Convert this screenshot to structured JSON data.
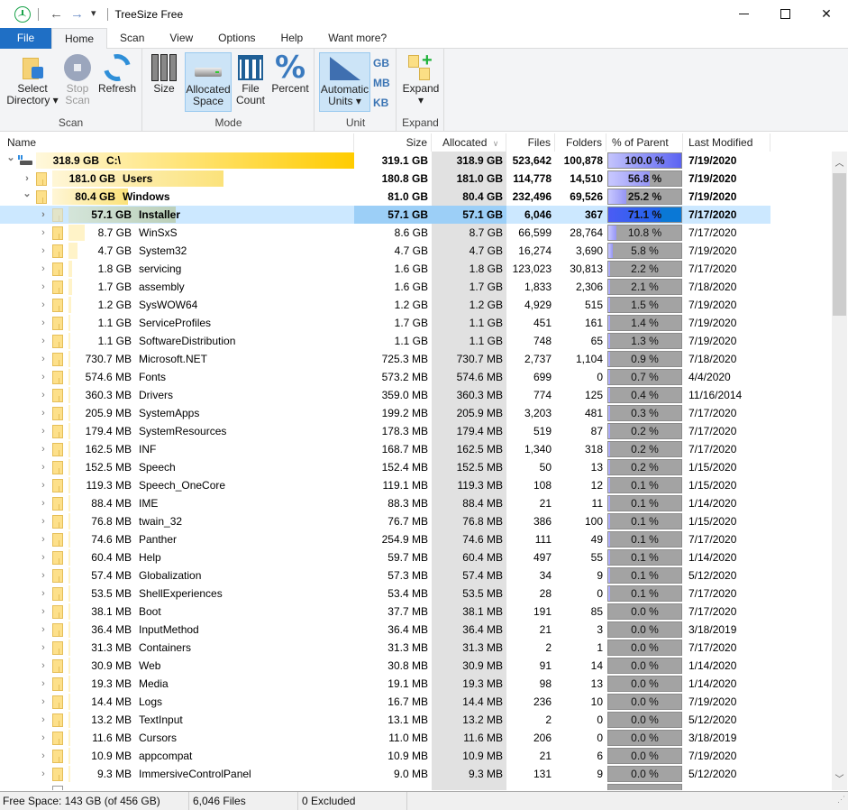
{
  "window": {
    "title": "TreeSize Free",
    "back_icon": "arrow-left-icon",
    "forward_icon": "arrow-right-icon",
    "quick_access_icon": "quick-access-dropdown-icon",
    "minimize_icon": "minimize-icon",
    "maximize_icon": "maximize-icon",
    "close_icon": "close-icon"
  },
  "ribbon_tabs": [
    "File",
    "Home",
    "Scan",
    "View",
    "Options",
    "Help",
    "Want more?"
  ],
  "active_tab": "Home",
  "ribbon": {
    "groups": {
      "scan": "Scan",
      "mode": "Mode",
      "unit": "Unit",
      "expand": "Expand"
    },
    "buttons": {
      "select_directory": [
        "Select",
        "Directory ▾"
      ],
      "stop_scan": [
        "Stop",
        "Scan"
      ],
      "refresh": [
        "Refresh",
        ""
      ],
      "size": [
        "Size",
        ""
      ],
      "allocated_space": [
        "Allocated",
        "Space"
      ],
      "file_count": [
        "File",
        "Count"
      ],
      "percent": [
        "Percent",
        ""
      ],
      "automatic_units": [
        "Automatic",
        "Units ▾"
      ],
      "gb": "GB",
      "mb": "MB",
      "kb": "KB",
      "expand": [
        "Expand",
        "▾"
      ]
    }
  },
  "columns": {
    "name": "Name",
    "size": "Size",
    "allocated": "Allocated",
    "files": "Files",
    "folders": "Folders",
    "percent_parent": "% of Parent ...",
    "last_modified": "Last Modified"
  },
  "sort_column": "allocated",
  "rows": [
    {
      "level": 0,
      "expanded": true,
      "type": "drive",
      "bold": true,
      "allocated_label": "318.9 GB",
      "name": "C:\\",
      "size": "319.1 GB",
      "allocated": "318.9 GB",
      "files": "523,642",
      "folders": "100,878",
      "percent": 100.0,
      "percent_label": "100.0 %",
      "modified": "7/19/2020",
      "namebar": 1.0
    },
    {
      "level": 1,
      "expanded": false,
      "type": "folder",
      "bold": true,
      "name": "Users",
      "size": "180.8 GB",
      "allocated": "181.0 GB",
      "files": "114,778",
      "folders": "14,510",
      "percent": 56.8,
      "percent_label": "56.8 %",
      "modified": "7/19/2020",
      "namebar": 0.568
    },
    {
      "level": 1,
      "expanded": true,
      "type": "folder",
      "bold": true,
      "name": "Windows",
      "size": "81.0 GB",
      "allocated": "80.4 GB",
      "files": "232,496",
      "folders": "69,526",
      "percent": 25.2,
      "percent_label": "25.2 %",
      "modified": "7/19/2020",
      "namebar": 0.252
    },
    {
      "level": 2,
      "expanded": false,
      "type": "folder",
      "bold": true,
      "selected": true,
      "name": "Installer",
      "size": "57.1 GB",
      "allocated": "57.1 GB",
      "files": "6,046",
      "folders": "367",
      "percent": 71.1,
      "percent_label": "71.1 %",
      "modified": "7/17/2020",
      "namebar": 0.711
    },
    {
      "level": 2,
      "name": "WinSxS",
      "size": "8.6 GB",
      "allocated": "8.7 GB",
      "files": "66,599",
      "folders": "28,764",
      "percent": 10.8,
      "percent_label": "10.8 %",
      "modified": "7/17/2020",
      "namebar": 0.108
    },
    {
      "level": 2,
      "name": "System32",
      "size": "4.7 GB",
      "allocated": "4.7 GB",
      "files": "16,274",
      "folders": "3,690",
      "percent": 5.8,
      "percent_label": "5.8 %",
      "modified": "7/19/2020",
      "namebar": 0.058
    },
    {
      "level": 2,
      "name": "servicing",
      "size": "1.6 GB",
      "allocated": "1.8 GB",
      "files": "123,023",
      "folders": "30,813",
      "percent": 2.2,
      "percent_label": "2.2 %",
      "modified": "7/17/2020",
      "namebar": 0.022
    },
    {
      "level": 2,
      "name": "assembly",
      "size": "1.6 GB",
      "allocated": "1.7 GB",
      "files": "1,833",
      "folders": "2,306",
      "percent": 2.1,
      "percent_label": "2.1 %",
      "modified": "7/18/2020",
      "namebar": 0.021
    },
    {
      "level": 2,
      "name": "SysWOW64",
      "size": "1.2 GB",
      "allocated": "1.2 GB",
      "files": "4,929",
      "folders": "515",
      "percent": 1.5,
      "percent_label": "1.5 %",
      "modified": "7/19/2020",
      "namebar": 0.015
    },
    {
      "level": 2,
      "name": "ServiceProfiles",
      "size": "1.7 GB",
      "allocated": "1.1 GB",
      "files": "451",
      "folders": "161",
      "percent": 1.4,
      "percent_label": "1.4 %",
      "modified": "7/19/2020",
      "namebar": 0.014
    },
    {
      "level": 2,
      "name": "SoftwareDistribution",
      "size": "1.1 GB",
      "allocated": "1.1 GB",
      "files": "748",
      "folders": "65",
      "percent": 1.3,
      "percent_label": "1.3 %",
      "modified": "7/19/2020",
      "namebar": 0.013
    },
    {
      "level": 2,
      "name": "Microsoft.NET",
      "size": "725.3 MB",
      "allocated": "730.7 MB",
      "files": "2,737",
      "folders": "1,104",
      "percent": 0.9,
      "percent_label": "0.9 %",
      "modified": "7/18/2020",
      "namebar": 0.009
    },
    {
      "level": 2,
      "name": "Fonts",
      "size": "573.2 MB",
      "allocated": "574.6 MB",
      "files": "699",
      "folders": "0",
      "percent": 0.7,
      "percent_label": "0.7 %",
      "modified": "4/4/2020",
      "namebar": 0.007
    },
    {
      "level": 2,
      "name": "Drivers",
      "size": "359.0 MB",
      "allocated": "360.3 MB",
      "files": "774",
      "folders": "125",
      "percent": 0.4,
      "percent_label": "0.4 %",
      "modified": "11/16/2014",
      "namebar": 0.004
    },
    {
      "level": 2,
      "name": "SystemApps",
      "size": "199.2 MB",
      "allocated": "205.9 MB",
      "files": "3,203",
      "folders": "481",
      "percent": 0.3,
      "percent_label": "0.3 %",
      "modified": "7/17/2020",
      "namebar": 0.003
    },
    {
      "level": 2,
      "name": "SystemResources",
      "size": "178.3 MB",
      "allocated": "179.4 MB",
      "files": "519",
      "folders": "87",
      "percent": 0.2,
      "percent_label": "0.2 %",
      "modified": "7/17/2020",
      "namebar": 0.002
    },
    {
      "level": 2,
      "name": "INF",
      "size": "168.7 MB",
      "allocated": "162.5 MB",
      "files": "1,340",
      "folders": "318",
      "percent": 0.2,
      "percent_label": "0.2 %",
      "modified": "7/17/2020",
      "namebar": 0.002
    },
    {
      "level": 2,
      "name": "Speech",
      "size": "152.4 MB",
      "allocated": "152.5 MB",
      "files": "50",
      "folders": "13",
      "percent": 0.2,
      "percent_label": "0.2 %",
      "modified": "1/15/2020",
      "namebar": 0.002
    },
    {
      "level": 2,
      "name": "Speech_OneCore",
      "size": "119.1 MB",
      "allocated": "119.3 MB",
      "files": "108",
      "folders": "12",
      "percent": 0.1,
      "percent_label": "0.1 %",
      "modified": "1/15/2020",
      "namebar": 0.001
    },
    {
      "level": 2,
      "name": "IME",
      "size": "88.3 MB",
      "allocated": "88.4 MB",
      "files": "21",
      "folders": "11",
      "percent": 0.1,
      "percent_label": "0.1 %",
      "modified": "1/14/2020",
      "namebar": 0.001
    },
    {
      "level": 2,
      "name": "twain_32",
      "size": "76.7 MB",
      "allocated": "76.8 MB",
      "files": "386",
      "folders": "100",
      "percent": 0.1,
      "percent_label": "0.1 %",
      "modified": "1/15/2020",
      "namebar": 0.001
    },
    {
      "level": 2,
      "name": "Panther",
      "size": "254.9 MB",
      "allocated": "74.6 MB",
      "files": "111",
      "folders": "49",
      "percent": 0.1,
      "percent_label": "0.1 %",
      "modified": "7/17/2020",
      "namebar": 0.001
    },
    {
      "level": 2,
      "name": "Help",
      "size": "59.7 MB",
      "allocated": "60.4 MB",
      "files": "497",
      "folders": "55",
      "percent": 0.1,
      "percent_label": "0.1 %",
      "modified": "1/14/2020",
      "namebar": 0.001
    },
    {
      "level": 2,
      "name": "Globalization",
      "size": "57.3 MB",
      "allocated": "57.4 MB",
      "files": "34",
      "folders": "9",
      "percent": 0.1,
      "percent_label": "0.1 %",
      "modified": "5/12/2020",
      "namebar": 0.001
    },
    {
      "level": 2,
      "name": "ShellExperiences",
      "size": "53.4 MB",
      "allocated": "53.5 MB",
      "files": "28",
      "folders": "0",
      "percent": 0.1,
      "percent_label": "0.1 %",
      "modified": "7/17/2020",
      "namebar": 0.001
    },
    {
      "level": 2,
      "name": "Boot",
      "size": "37.7 MB",
      "allocated": "38.1 MB",
      "files": "191",
      "folders": "85",
      "percent": 0.0,
      "percent_label": "0.0 %",
      "modified": "7/17/2020",
      "namebar": 0
    },
    {
      "level": 2,
      "name": "InputMethod",
      "size": "36.4 MB",
      "allocated": "36.4 MB",
      "files": "21",
      "folders": "3",
      "percent": 0.0,
      "percent_label": "0.0 %",
      "modified": "3/18/2019",
      "namebar": 0
    },
    {
      "level": 2,
      "name": "Containers",
      "size": "31.3 MB",
      "allocated": "31.3 MB",
      "files": "2",
      "folders": "1",
      "percent": 0.0,
      "percent_label": "0.0 %",
      "modified": "7/17/2020",
      "namebar": 0
    },
    {
      "level": 2,
      "name": "Web",
      "size": "30.8 MB",
      "allocated": "30.9 MB",
      "files": "91",
      "folders": "14",
      "percent": 0.0,
      "percent_label": "0.0 %",
      "modified": "1/14/2020",
      "namebar": 0
    },
    {
      "level": 2,
      "name": "Media",
      "size": "19.1 MB",
      "allocated": "19.3 MB",
      "files": "98",
      "folders": "13",
      "percent": 0.0,
      "percent_label": "0.0 %",
      "modified": "1/14/2020",
      "namebar": 0
    },
    {
      "level": 2,
      "name": "Logs",
      "size": "16.7 MB",
      "allocated": "14.4 MB",
      "files": "236",
      "folders": "10",
      "percent": 0.0,
      "percent_label": "0.0 %",
      "modified": "7/19/2020",
      "namebar": 0
    },
    {
      "level": 2,
      "name": "TextInput",
      "size": "13.1 MB",
      "allocated": "13.2 MB",
      "files": "2",
      "folders": "0",
      "percent": 0.0,
      "percent_label": "0.0 %",
      "modified": "5/12/2020",
      "namebar": 0
    },
    {
      "level": 2,
      "name": "Cursors",
      "size": "11.0 MB",
      "allocated": "11.6 MB",
      "files": "206",
      "folders": "0",
      "percent": 0.0,
      "percent_label": "0.0 %",
      "modified": "3/18/2019",
      "namebar": 0
    },
    {
      "level": 2,
      "name": "appcompat",
      "size": "10.9 MB",
      "allocated": "10.9 MB",
      "files": "21",
      "folders": "6",
      "percent": 0.0,
      "percent_label": "0.0 %",
      "modified": "7/19/2020",
      "namebar": 0
    },
    {
      "level": 2,
      "name": "ImmersiveControlPanel",
      "size": "9.0 MB",
      "allocated": "9.3 MB",
      "files": "131",
      "folders": "9",
      "percent": 0.0,
      "percent_label": "0.0 %",
      "modified": "5/12/2020",
      "namebar": 0
    }
  ],
  "colors": {
    "file_tab": "#1f6fc5",
    "selected_row": "#cce8ff",
    "namebar_yellow": "#ffcc00",
    "percent_fill": "#b9b9fd",
    "percent_fill_dark": "#5a5ff0",
    "percent_bg": "#a3a3a3"
  },
  "status": {
    "free_space": "Free Space: 143 GB  (of 456 GB)",
    "files": "6,046 Files",
    "excluded": "0 Excluded"
  }
}
